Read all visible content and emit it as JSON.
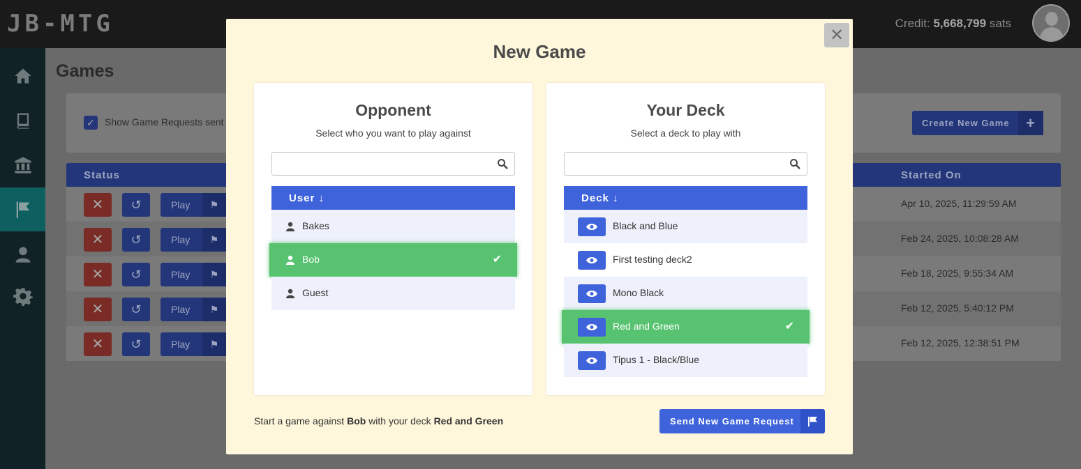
{
  "app": {
    "brand": "JB-MTG",
    "credit_label": "Credit:",
    "credit_value": "5,668,799",
    "credit_unit": "sats"
  },
  "sidebar": {
    "items": [
      {
        "icon": "home-icon"
      },
      {
        "icon": "book-icon"
      },
      {
        "icon": "bank-icon"
      },
      {
        "icon": "flag-icon",
        "active": true
      },
      {
        "icon": "user-icon"
      },
      {
        "icon": "gear-icon"
      }
    ]
  },
  "page": {
    "title": "Games",
    "filter_label": "Show Game Requests sent t",
    "create_button": "Create New Game",
    "columns": {
      "status": "Status",
      "started_on": "Started On"
    },
    "play_label": "Play",
    "rows": [
      {
        "started_on": "Apr 10, 2025, 11:29:59 AM"
      },
      {
        "started_on": "Feb 24, 2025, 10:08:28 AM"
      },
      {
        "started_on": "Feb 18, 2025, 9:55:34 AM"
      },
      {
        "started_on": "Feb 12, 2025, 5:40:12 PM"
      },
      {
        "started_on": "Feb 12, 2025, 12:38:51 PM"
      }
    ]
  },
  "modal": {
    "title": "New Game",
    "opponent": {
      "title": "Opponent",
      "subtitle": "Select who you want to play against",
      "search_value": "",
      "column": "User",
      "users": [
        "Bakes",
        "Bob",
        "Guest"
      ],
      "selected": "Bob"
    },
    "deck": {
      "title": "Your Deck",
      "subtitle": "Select a deck to play with",
      "search_value": "",
      "column": "Deck",
      "decks": [
        "Black and Blue",
        "First testing deck2",
        "Mono Black",
        "Red and Green",
        "Tipus 1 - Black/Blue"
      ],
      "selected": "Red and Green"
    },
    "summary": {
      "prefix": "Start a game against",
      "opponent": "Bob",
      "middle": "with your deck",
      "deck": "Red and Green"
    },
    "send_button": "Send New Game Request"
  },
  "colors": {
    "accent": "#3f63db",
    "selected": "#57c26f",
    "modal_bg": "#fff7dc",
    "danger": "#c0392b"
  }
}
